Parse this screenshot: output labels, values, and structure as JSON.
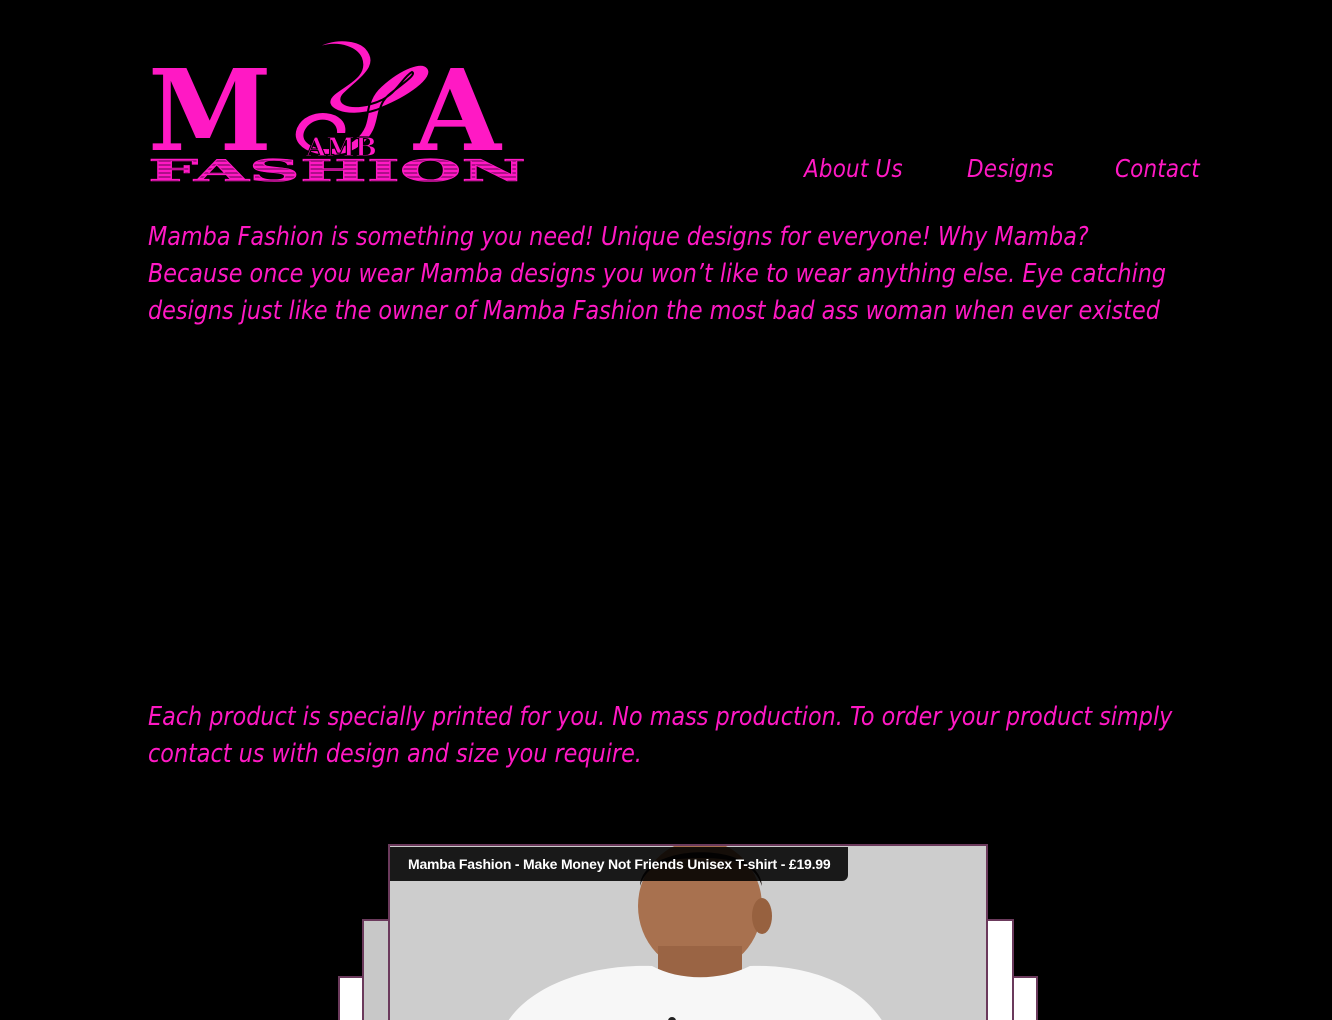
{
  "brand": {
    "logo_big_letters_left": "M",
    "logo_big_letters_right": "A",
    "logo_middle": "AMB",
    "logo_bottom": "FASHION",
    "color": "#ff19c4"
  },
  "nav": {
    "items": [
      {
        "label": "About Us"
      },
      {
        "label": "Designs"
      },
      {
        "label": "Contact"
      }
    ]
  },
  "intro": {
    "text": "Mamba Fashion is something you need! Unique designs for everyone! Why Mamba? Because once you wear Mamba designs you won’t like to wear anything else. Eye catching designs just like the owner of Mamba Fashion the most bad ass woman when ever existed"
  },
  "order_note": {
    "text": "Each product is specially printed for you. No mass production. To order your product simply contact us with design and size you require."
  },
  "gallery": {
    "caption": "Mamba Fashion - Make Money Not Friends Unisex T-shirt - £19.99"
  }
}
